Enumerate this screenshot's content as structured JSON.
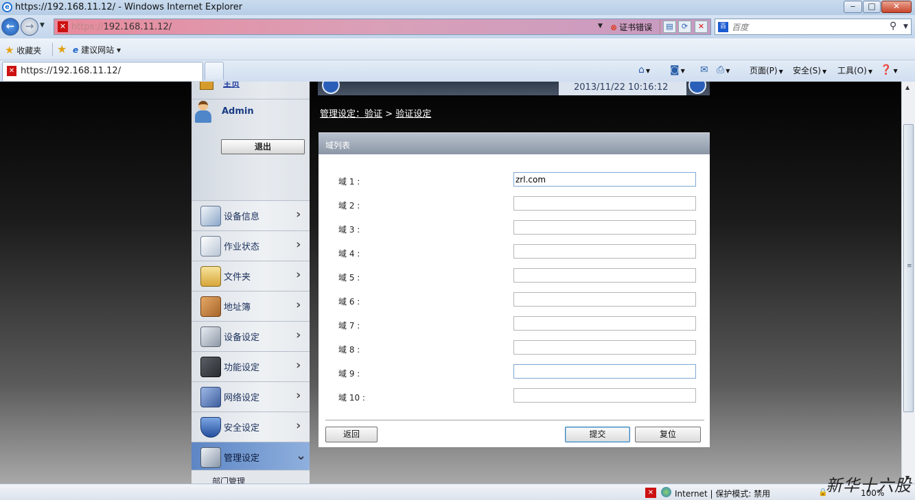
{
  "window": {
    "title": "https://192.168.11.12/ - Windows Internet Explorer"
  },
  "addressbar": {
    "url_protocol": "https://",
    "url_host": "192.168.11.12/",
    "cert_error": "证书错误"
  },
  "search": {
    "placeholder": "百度"
  },
  "favorites_bar": {
    "favorites_label": "收藏夹",
    "suggested_sites_label": "建议网站"
  },
  "tab": {
    "title": "https://192.168.11.12/"
  },
  "command_bar": {
    "page_label": "页面(P)",
    "safety_label": "安全(S)",
    "tools_label": "工具(O)"
  },
  "sidebar": {
    "top_link_label": "主页",
    "username": "Admin",
    "logout_label": "退出",
    "items": [
      {
        "label": "设备信息",
        "icon": "device-info-icon"
      },
      {
        "label": "作业状态",
        "icon": "job-status-icon"
      },
      {
        "label": "文件夹",
        "icon": "folder-icon"
      },
      {
        "label": "地址簿",
        "icon": "address-book-icon"
      },
      {
        "label": "设备设定",
        "icon": "device-settings-icon"
      },
      {
        "label": "功能设定",
        "icon": "function-settings-icon"
      },
      {
        "label": "网络设定",
        "icon": "network-settings-icon"
      },
      {
        "label": "安全设定",
        "icon": "security-settings-icon"
      },
      {
        "label": "管理设定",
        "icon": "management-settings-icon",
        "active": true
      }
    ],
    "submenu_item": "部门管理"
  },
  "header": {
    "datetime": "2013/11/22 10:16:12"
  },
  "breadcrumb": {
    "part1": "管理设定：验证",
    "separator": " > ",
    "part2": "验证设定"
  },
  "panel": {
    "title": "域列表",
    "fields": [
      {
        "label": "域 1 :",
        "value": "zrl.com"
      },
      {
        "label": "域 2 :",
        "value": ""
      },
      {
        "label": "域 3 :",
        "value": ""
      },
      {
        "label": "域 4 :",
        "value": ""
      },
      {
        "label": "域 5 :",
        "value": ""
      },
      {
        "label": "域 6 :",
        "value": ""
      },
      {
        "label": "域 7 :",
        "value": ""
      },
      {
        "label": "域 8 :",
        "value": ""
      },
      {
        "label": "域 9 :",
        "value": ""
      },
      {
        "label": "域 10 :",
        "value": ""
      }
    ],
    "back_label": "返回",
    "submit_label": "提交",
    "reset_label": "复位"
  },
  "statusbar": {
    "zone_text": "Internet | 保护模式: 禁用",
    "zoom": "100%"
  },
  "watermark": "新华十六股",
  "colors": {
    "active_menu": "#5d86c4",
    "panel_header": "#8b96a6",
    "cert_error_bar": "#e88b9d"
  }
}
